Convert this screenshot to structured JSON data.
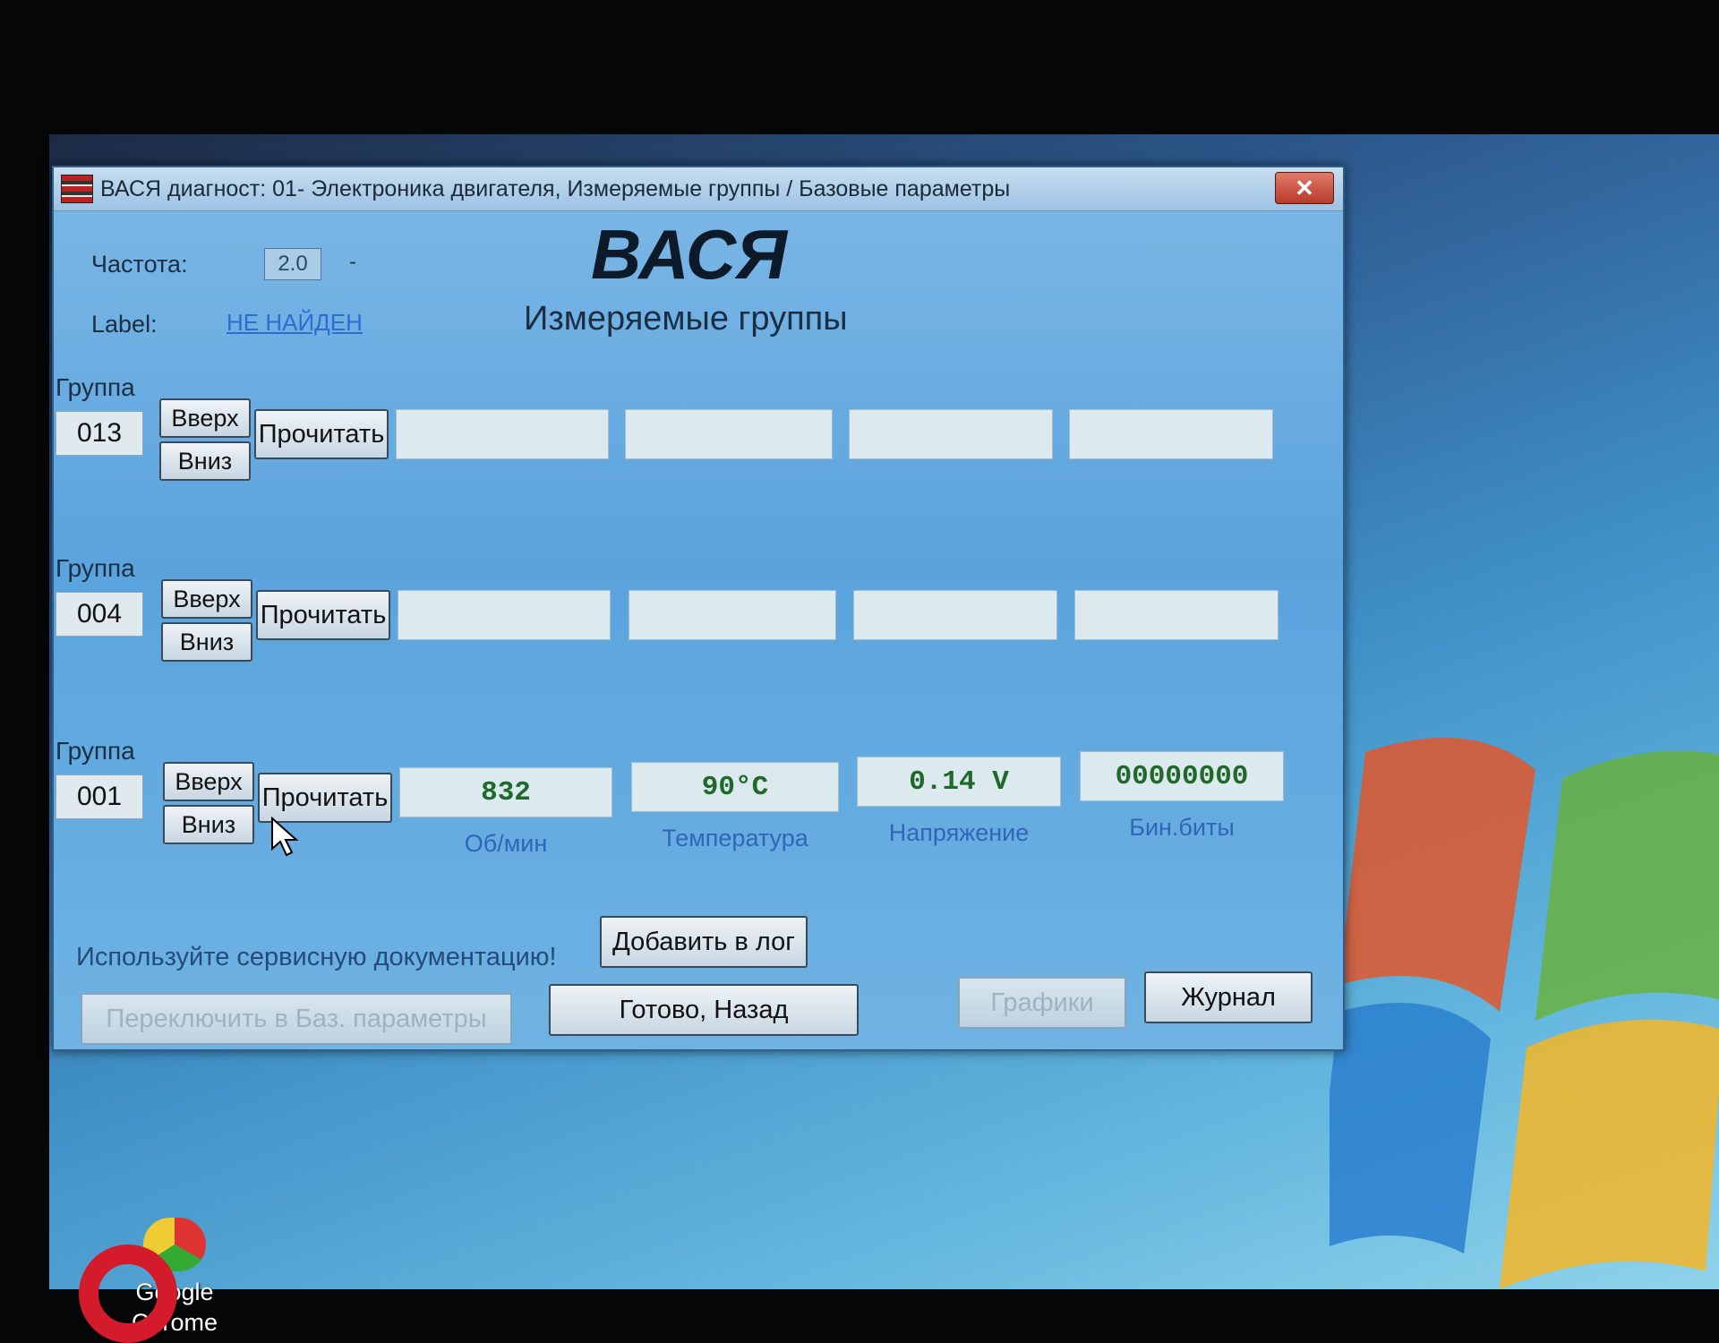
{
  "window": {
    "title": "ВАСЯ диагност: 01- Электроника двигателя,  Измеряемые группы / Базовые параметры",
    "close_glyph": "✕"
  },
  "header": {
    "freq_label": "Частота:",
    "freq_value": "2.0",
    "freq_dash": "-",
    "label_label": "Label:",
    "label_value": "НЕ НАЙДЕН",
    "brand": "ВАСЯ",
    "subtitle": "Измеряемые группы"
  },
  "groups": [
    {
      "label": "Группа",
      "number": "013",
      "up_label": "Вверх",
      "down_label": "Вниз",
      "read_label": "Прочитать",
      "fields": [
        "",
        "",
        "",
        ""
      ],
      "units": [
        "",
        "",
        "",
        ""
      ]
    },
    {
      "label": "Группа",
      "number": "004",
      "up_label": "Вверх",
      "down_label": "Вниз",
      "read_label": "Прочитать",
      "fields": [
        "",
        "",
        "",
        ""
      ],
      "units": [
        "",
        "",
        "",
        ""
      ]
    },
    {
      "label": "Группа",
      "number": "001",
      "up_label": "Вверх",
      "down_label": "Вниз",
      "read_label": "Прочитать",
      "fields": [
        "832",
        "90°C",
        "0.14 V",
        "00000000"
      ],
      "units": [
        "Об/мин",
        "Температура",
        "Напряжение",
        "Бин.биты"
      ]
    }
  ],
  "footer": {
    "hint": "Используйте сервисную документацию!",
    "add_log": "Добавить в лог",
    "switch_basic": "Переключить в Баз. параметры",
    "done_back": "Готово, Назад",
    "graphs": "Графики",
    "journal": "Журнал"
  },
  "desktop": {
    "icon_label_line1": "Google",
    "icon_label_line2": "Chrome"
  }
}
